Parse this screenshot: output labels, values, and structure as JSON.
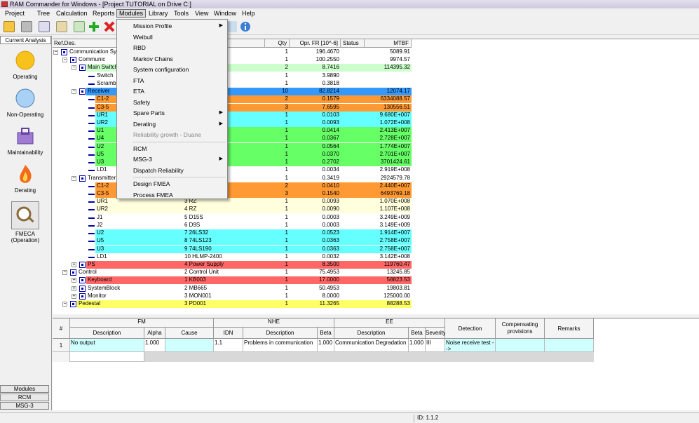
{
  "window_title": "RAM Commander for Windows - [Project TUTORIAL on Drive C:]",
  "menubar": [
    "Project",
    "Tree",
    "Calculation",
    "Reports",
    "Modules",
    "Library",
    "Tools",
    "View",
    "Window",
    "Help"
  ],
  "active_menu": "Modules",
  "modules_menu": [
    {
      "label": "Mission Profile",
      "submenu": true
    },
    {
      "label": "Weibull"
    },
    {
      "label": "RBD"
    },
    {
      "label": "Markov Chains"
    },
    {
      "label": "System configuration"
    },
    {
      "label": "FTA"
    },
    {
      "label": "ETA"
    },
    {
      "label": "Safety"
    },
    {
      "label": "Spare Parts",
      "submenu": true
    },
    {
      "label": "Derating",
      "submenu": true
    },
    {
      "label": "Reliability growth - Duane",
      "disabled": true
    },
    {
      "label": "RCM"
    },
    {
      "label": "MSG-3",
      "submenu": true
    },
    {
      "label": "Dispatch Reliability"
    },
    {
      "label": "Design FMEA"
    },
    {
      "label": "Process FMEA"
    }
  ],
  "left_panel": {
    "tab": "Current Analysis",
    "items": [
      "Operating",
      "Non-Operating",
      "Maintainability",
      "Derating",
      "FMECA\n(Operation)"
    ],
    "bottom_tabs": [
      "Modules",
      "RCM",
      "MSG-3"
    ]
  },
  "tree_columns": [
    "Ref.Des.",
    "Qty",
    "Opr. FR [10^-6]",
    "Status",
    "MTBF"
  ],
  "tree_rows": [
    {
      "indent": 0,
      "name": "Communication System",
      "desc": "System",
      "qty": "1",
      "fr": "196.4670",
      "mtbf": "5089.91",
      "color": ""
    },
    {
      "indent": 1,
      "name": "Communic",
      "desc": "",
      "qty": "1",
      "fr": "100.2550",
      "mtbf": "9974.57",
      "color": ""
    },
    {
      "indent": 2,
      "name": "Main Switch",
      "desc": "",
      "qty": "2",
      "fr": "8.7416",
      "mtbf": "114395.32",
      "color": "#ccffcc"
    },
    {
      "indent": 3,
      "name": "Switch",
      "desc": "",
      "qty": "1",
      "fr": "3.9890",
      "mtbf": "",
      "color": ""
    },
    {
      "indent": 3,
      "name": "Scramb",
      "desc": "",
      "qty": "1",
      "fr": "0.3818",
      "mtbf": "",
      "color": ""
    },
    {
      "indent": 2,
      "name": "Receiver",
      "desc": "",
      "qty": "10",
      "fr": "82.8214",
      "mtbf": "12074.17",
      "color": "#3399ff"
    },
    {
      "indent": 3,
      "name": "C1-2",
      "desc": "",
      "qty": "2",
      "fr": "0.1579",
      "mtbf": "6334088.57",
      "color": "#ff9933"
    },
    {
      "indent": 3,
      "name": "C3-5",
      "desc": "",
      "qty": "3",
      "fr": "7.6595",
      "mtbf": "130556.51",
      "color": "#ff9933"
    },
    {
      "indent": 3,
      "name": "UR1",
      "desc": "",
      "qty": "1",
      "fr": "0.0103",
      "mtbf": "9.680E+007",
      "color": "#66ffff"
    },
    {
      "indent": 3,
      "name": "UR2",
      "desc": "",
      "qty": "1",
      "fr": "0.0093",
      "mtbf": "1.072E+008",
      "color": "#66ffff"
    },
    {
      "indent": 3,
      "name": "U1",
      "desc": "",
      "qty": "1",
      "fr": "0.0414",
      "mtbf": "2.413E+007",
      "color": "#66ff66"
    },
    {
      "indent": 3,
      "name": "U4",
      "desc": "",
      "qty": "1",
      "fr": "0.0367",
      "mtbf": "2.728E+007",
      "color": "#66ff66"
    },
    {
      "indent": 3,
      "name": "U2",
      "desc": "",
      "qty": "1",
      "fr": "0.0564",
      "mtbf": "1.774E+007",
      "color": "#66ff66"
    },
    {
      "indent": 3,
      "name": "U5",
      "desc": "",
      "qty": "1",
      "fr": "0.0370",
      "mtbf": "2.701E+007",
      "color": "#66ff66"
    },
    {
      "indent": 3,
      "name": "U3",
      "desc": "",
      "qty": "1",
      "fr": "0.2702",
      "mtbf": "3701424.61",
      "color": "#66ff66"
    },
    {
      "indent": 3,
      "name": "LD1",
      "desc": "",
      "qty": "1",
      "fr": "0.0034",
      "mtbf": "2.919E+008",
      "color": ""
    },
    {
      "indent": 2,
      "name": "Transmitter",
      "desc": "",
      "qty": "1",
      "fr": "0.3419",
      "mtbf": "2924579.78",
      "color": ""
    },
    {
      "indent": 3,
      "name": "C1-2",
      "desc": "",
      "qty": "2",
      "fr": "0.0410",
      "mtbf": "2.440E+007",
      "color": "#ff9933"
    },
    {
      "indent": 3,
      "name": "C3-5",
      "desc": "",
      "qty": "3",
      "fr": "0.1540",
      "mtbf": "6493769.18",
      "color": "#ff9933"
    },
    {
      "indent": 3,
      "name": "UR1",
      "desc": "3 RZ",
      "qty": "1",
      "fr": "0.0093",
      "mtbf": "1.070E+008",
      "color": "#ffffdd"
    },
    {
      "indent": 3,
      "name": "UR2",
      "desc": "4 RZ",
      "qty": "1",
      "fr": "0.0090",
      "mtbf": "1.107E+008",
      "color": "#ffffdd"
    },
    {
      "indent": 3,
      "name": "J1",
      "desc": "5 D15S",
      "qty": "1",
      "fr": "0.0003",
      "mtbf": "3.249E+009",
      "color": ""
    },
    {
      "indent": 3,
      "name": "J2",
      "desc": "6 D9S",
      "qty": "1",
      "fr": "0.0003",
      "mtbf": "3.149E+009",
      "color": ""
    },
    {
      "indent": 3,
      "name": "U2",
      "desc": "7 26LS32",
      "qty": "1",
      "fr": "0.0523",
      "mtbf": "1.914E+007",
      "color": "#66ffff"
    },
    {
      "indent": 3,
      "name": "U5",
      "desc": "8 74LS123",
      "qty": "1",
      "fr": "0.0363",
      "mtbf": "2.758E+007",
      "color": "#66ffff"
    },
    {
      "indent": 3,
      "name": "U3",
      "desc": "9 74LS190",
      "qty": "1",
      "fr": "0.0363",
      "mtbf": "2.758E+007",
      "color": "#66ffff"
    },
    {
      "indent": 3,
      "name": "LD1",
      "desc": "10 HLMP-2400",
      "qty": "1",
      "fr": "0.0032",
      "mtbf": "3.142E+008",
      "color": ""
    },
    {
      "indent": 2,
      "name": "PS",
      "desc": "4 Power Supply",
      "qty": "1",
      "fr": "8.3500",
      "mtbf": "119760.47",
      "color": "#ff6666"
    },
    {
      "indent": 1,
      "name": "Control",
      "desc": "2 Control Unit",
      "qty": "1",
      "fr": "75.4953",
      "mtbf": "13245.85",
      "color": ""
    },
    {
      "indent": 2,
      "name": "Keyboard",
      "desc": "1 KB003",
      "qty": "1",
      "fr": "17.0000",
      "mtbf": "58823.53",
      "color": "#ff6666"
    },
    {
      "indent": 2,
      "name": "SystemBlock",
      "desc": "2 MB665",
      "qty": "1",
      "fr": "50.4953",
      "mtbf": "19803.81",
      "color": ""
    },
    {
      "indent": 2,
      "name": "Monitor",
      "desc": "3 MON001",
      "qty": "1",
      "fr": "8.0000",
      "mtbf": "125000.00",
      "color": ""
    },
    {
      "indent": 1,
      "name": "Pedestal",
      "desc": "3 PD001",
      "qty": "1",
      "fr": "11.3265",
      "mtbf": "88288.53",
      "color": "#ffff66"
    }
  ],
  "fmea": {
    "groups": [
      "FM",
      "NHE",
      "EE"
    ],
    "headers": [
      "#",
      "Description",
      "Alpha",
      "Cause",
      "IDN",
      "Description",
      "Beta",
      "Description",
      "Beta",
      "Severity",
      "Detection",
      "Compensating provisions",
      "Remarks"
    ],
    "row": {
      "num": "1",
      "fm_desc": "No output",
      "alpha": "1.000",
      "cause": "",
      "idn": "1.1",
      "nhe_desc": "Problems in communication",
      "nhe_beta": "1.000",
      "ee_desc": "Communication Degradation",
      "ee_beta": "1.000",
      "severity": "III",
      "detection": "Noise receive test -->",
      "comp": "",
      "remarks": ""
    }
  },
  "status": {
    "id": "ID: 1.1.2"
  }
}
